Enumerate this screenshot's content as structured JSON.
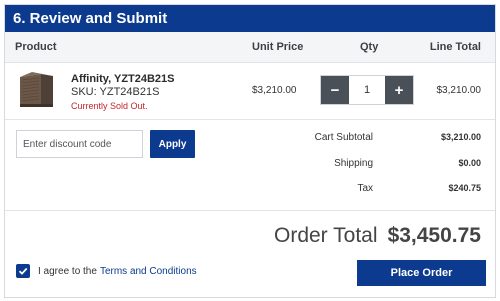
{
  "section": {
    "title": "6. Review and Submit"
  },
  "table": {
    "headers": {
      "product": "Product",
      "unit_price": "Unit Price",
      "qty": "Qty",
      "line_total": "Line Total"
    },
    "item": {
      "name": "Affinity, YZT24B21S",
      "sku": "SKU: YZT24B21S",
      "status": "Currently Sold Out.",
      "unit_price": "$3,210.00",
      "qty": "1",
      "qty_minus": "−",
      "qty_plus": "+",
      "line_total": "$3,210.00",
      "image_icon": "hvac-unit-icon"
    }
  },
  "discount": {
    "placeholder": "Enter discount code",
    "apply_label": "Apply"
  },
  "summary": {
    "cart_subtotal_label": "Cart Subtotal",
    "cart_subtotal_value": "$3,210.00",
    "shipping_label": "Shipping",
    "shipping_value": "$0.00",
    "tax_label": "Tax",
    "tax_value": "$240.75",
    "order_total_label": "Order Total",
    "order_total_value": "$3,450.75"
  },
  "agreement": {
    "text": "I agree to the",
    "link": "Terms and Conditions",
    "checked": true
  },
  "actions": {
    "place_order_label": "Place Order"
  },
  "colors": {
    "primary": "#0b3a8f",
    "qty_buttons": "#495057",
    "sold_out": "#c1272d"
  }
}
